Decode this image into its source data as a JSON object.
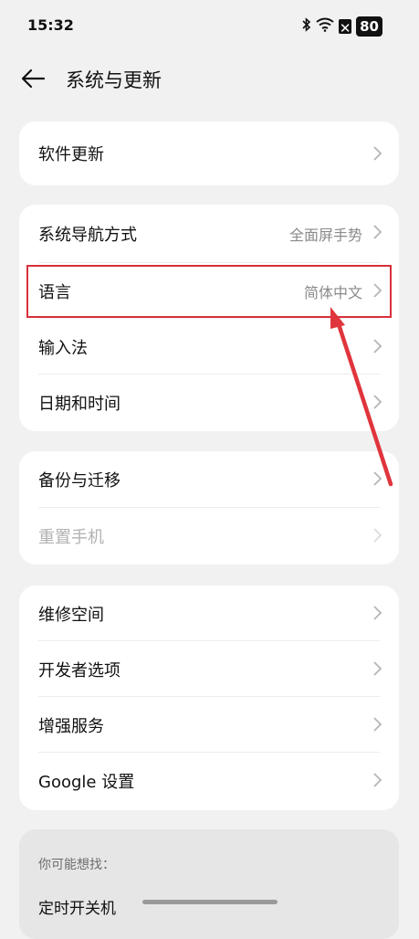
{
  "status": {
    "time": "15:32",
    "battery": "80"
  },
  "header": {
    "title": "系统与更新"
  },
  "group1": [
    {
      "label": "软件更新"
    }
  ],
  "group2": [
    {
      "label": "系统导航方式",
      "value": "全面屏手势"
    },
    {
      "label": "语言",
      "value": "简体中文"
    },
    {
      "label": "输入法"
    },
    {
      "label": "日期和时间"
    }
  ],
  "group3": [
    {
      "label": "备份与迁移"
    },
    {
      "label": "重置手机"
    }
  ],
  "group4": [
    {
      "label": "维修空间"
    },
    {
      "label": "开发者选项"
    },
    {
      "label": "增强服务"
    },
    {
      "label": "Google 设置"
    }
  ],
  "suggestions": {
    "title": "你可能想找：",
    "items": [
      "定时开关机"
    ]
  },
  "colors": {
    "highlight": "#d8303a",
    "background": "#f1f1f1"
  }
}
